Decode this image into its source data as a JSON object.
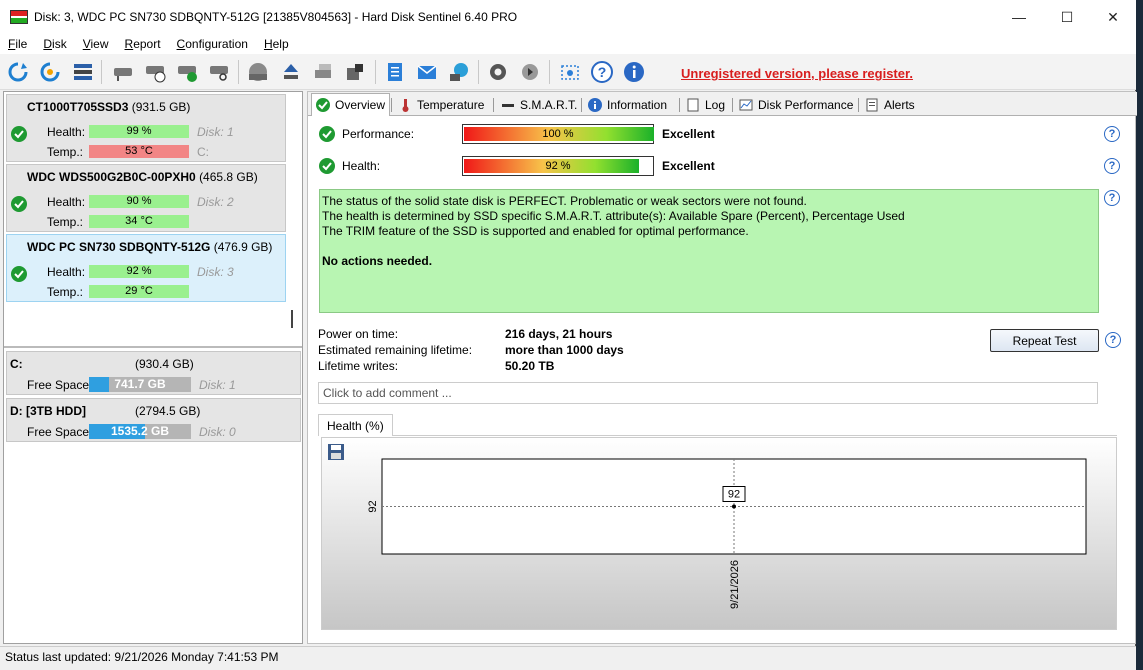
{
  "window": {
    "title": "Disk: 3, WDC PC SN730 SDBQNTY-512G [21385V804563]  -  Hard Disk Sentinel 6.40 PRO",
    "minimize": "—",
    "maximize": "☐",
    "close": "✕"
  },
  "menu": [
    {
      "key": "F",
      "rest": "ile"
    },
    {
      "key": "D",
      "rest": "isk"
    },
    {
      "key": "V",
      "rest": "iew"
    },
    {
      "key": "R",
      "rest": "eport"
    },
    {
      "key": "C",
      "rest": "onfiguration"
    },
    {
      "key": "H",
      "rest": "elp"
    }
  ],
  "toolbar": {
    "register_text": "Unregistered version, please register."
  },
  "disks": [
    {
      "name": "CT1000T705SSD3",
      "size": "(931.5 GB)",
      "health_label": "Health:",
      "health": "99 %",
      "health_fill": 99,
      "temp_label": "Temp.:",
      "temp": "53 °C",
      "temp_state": "hot",
      "disk_no": "Disk: 1",
      "drive": "C:"
    },
    {
      "name": "WDC WDS500G2B0C-00PXH0",
      "size": "(465.8 GB)",
      "health_label": "Health:",
      "health": "90 %",
      "health_fill": 90,
      "temp_label": "Temp.:",
      "temp": "34 °C",
      "temp_state": "ok",
      "disk_no": "Disk: 2",
      "drive": ""
    },
    {
      "name": "WDC PC SN730 SDBQNTY-512G",
      "size": "(476.9 GB)",
      "health_label": "Health:",
      "health": "92 %",
      "health_fill": 92,
      "temp_label": "Temp.:",
      "temp": "29 °C",
      "temp_state": "ok",
      "disk_no": "Disk: 3",
      "drive": ""
    }
  ],
  "volumes": [
    {
      "name": "C:",
      "size": "(930.4 GB)",
      "label": "Free Space",
      "free": "741.7 GB",
      "used_fraction": 0.2,
      "disk_no": "Disk: 1"
    },
    {
      "name": "D: [3TB HDD]",
      "size": "(2794.5 GB)",
      "label": "Free Space",
      "free": "1535.2 GB",
      "used_fraction": 0.55,
      "disk_no": "Disk: 0"
    }
  ],
  "tabs": [
    "Overview",
    "Temperature",
    "S.M.A.R.T.",
    "Information",
    "Log",
    "Disk Performance",
    "Alerts"
  ],
  "overview": {
    "performance": {
      "label": "Performance:",
      "value": "100 %",
      "level": 100,
      "rating": "Excellent"
    },
    "health": {
      "label": "Health:",
      "value": "92 %",
      "level": 92,
      "rating": "Excellent"
    },
    "status_lines": [
      "The status of the solid state disk is PERFECT. Problematic or weak sectors were not found.",
      "The health is determined by SSD specific S.M.A.R.T. attribute(s):  Available Spare (Percent), Percentage Used",
      "The TRIM feature of the SSD is supported and enabled for optimal performance."
    ],
    "status_action": "No actions needed.",
    "power_on_label": "Power on time:",
    "power_on_value": "216 days, 21 hours",
    "remaining_label": "Estimated remaining lifetime:",
    "remaining_value": "more than 1000 days",
    "writes_label": "Lifetime writes:",
    "writes_value": "50.20 TB",
    "repeat_button": "Repeat Test",
    "comment_placeholder": "Click to add comment ...",
    "help_symbol": "?"
  },
  "chart_data": {
    "type": "line",
    "title": "Health (%)",
    "x": [
      "9/21/2026"
    ],
    "series": [
      {
        "values": [
          92
        ]
      }
    ],
    "data_labels": [
      "92"
    ],
    "ytick": "92",
    "xtick": "9/21/2026",
    "ylim": [
      91,
      93
    ],
    "grid": true
  },
  "statusbar": {
    "text": "Status last updated: 9/21/2026 Monday 7:41:53 PM"
  },
  "colors": {
    "ok_green": "#9af08f",
    "hot_red": "#f28585",
    "register_red": "#d81e1e",
    "status_bg": "#b8f5b2",
    "accent_blue": "#2f9fe0"
  }
}
